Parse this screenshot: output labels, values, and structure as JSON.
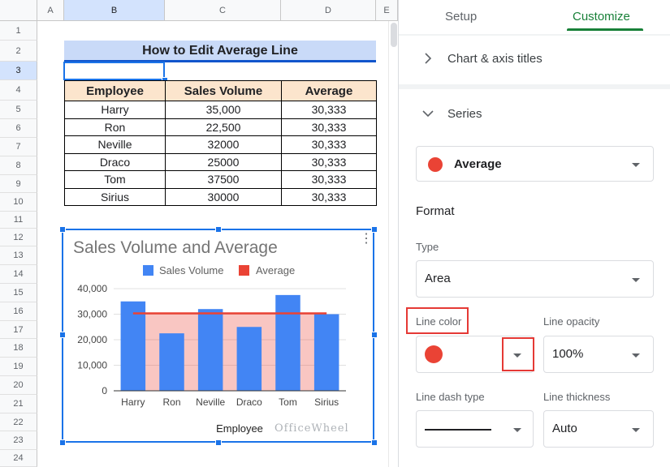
{
  "sheet": {
    "columns": [
      "A",
      "B",
      "C",
      "D",
      "E"
    ],
    "rows": [
      "1",
      "2",
      "3",
      "4",
      "5",
      "6",
      "7",
      "8",
      "9",
      "10",
      "11",
      "12",
      "13",
      "14",
      "15",
      "16",
      "17",
      "18",
      "19",
      "20",
      "21",
      "22",
      "23",
      "24"
    ],
    "title": "How to Edit Average Line",
    "table": {
      "headers": [
        "Employee",
        "Sales Volume",
        "Average"
      ],
      "rows": [
        [
          "Harry",
          "35,000",
          "30,333"
        ],
        [
          "Ron",
          "22,500",
          "30,333"
        ],
        [
          "Neville",
          "32000",
          "30,333"
        ],
        [
          "Draco",
          "25000",
          "30,333"
        ],
        [
          "Tom",
          "37500",
          "30,333"
        ],
        [
          "Sirius",
          "30000",
          "30,333"
        ]
      ]
    }
  },
  "chart_data": {
    "type": "bar",
    "title": "Sales Volume and Average",
    "xlabel": "Employee",
    "ylabel": "",
    "categories": [
      "Harry",
      "Ron",
      "Neville",
      "Draco",
      "Tom",
      "Sirius"
    ],
    "series": [
      {
        "name": "Sales Volume",
        "type": "bar",
        "color": "#4285f4",
        "values": [
          35000,
          22500,
          32000,
          25000,
          37500,
          30000
        ]
      },
      {
        "name": "Average",
        "type": "area",
        "color": "#ea4335",
        "values": [
          30333,
          30333,
          30333,
          30333,
          30333,
          30333
        ]
      }
    ],
    "ylim": [
      0,
      40000
    ],
    "yticks": [
      "0",
      "10,000",
      "20,000",
      "30,000",
      "40,000"
    ],
    "legend": "top",
    "grid": true
  },
  "watermark": "OfficeWheel",
  "panel": {
    "tabs": [
      "Setup",
      "Customize"
    ],
    "sections": {
      "chart_axis_titles": "Chart & axis titles",
      "series": "Series"
    },
    "series_select": "Average",
    "format_label": "Format",
    "type_label": "Type",
    "type_value": "Area",
    "line_color_label": "Line color",
    "line_opacity_label": "Line opacity",
    "line_opacity_value": "100%",
    "line_dash_label": "Line dash type",
    "line_thickness_label": "Line thickness",
    "line_thickness_value": "Auto",
    "colors": {
      "accent": "#188038",
      "series_color": "#ea4335",
      "highlight": "#e53935"
    }
  }
}
